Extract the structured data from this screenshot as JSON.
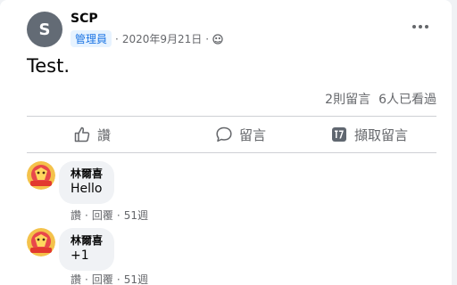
{
  "post": {
    "avatar_letter": "S",
    "author": "SCP",
    "role_badge": "管理員",
    "separator": "·",
    "date": "2020年9月21日",
    "privacy_icon": "globe-icon",
    "more_icon": "more-options-icon",
    "text": "Test.",
    "comments_count": "2則留言",
    "seen_count": "6人已看過"
  },
  "actions": {
    "like_label": "讚",
    "comment_label": "留言",
    "capture_label": "擷取留言"
  },
  "comments": [
    {
      "author": "林爾喜",
      "text": "Hello",
      "like": "讚",
      "reply": "回覆",
      "time": "51週",
      "dot": "·"
    },
    {
      "author": "林爾喜",
      "text": "+1",
      "like": "讚",
      "reply": "回覆",
      "time": "51週",
      "dot": "·"
    }
  ],
  "colors": {
    "accent": "#1b74e4",
    "badge_bg": "#e7f3ff",
    "secondary_text": "#65676b",
    "bubble_bg": "#f0f2f5"
  }
}
